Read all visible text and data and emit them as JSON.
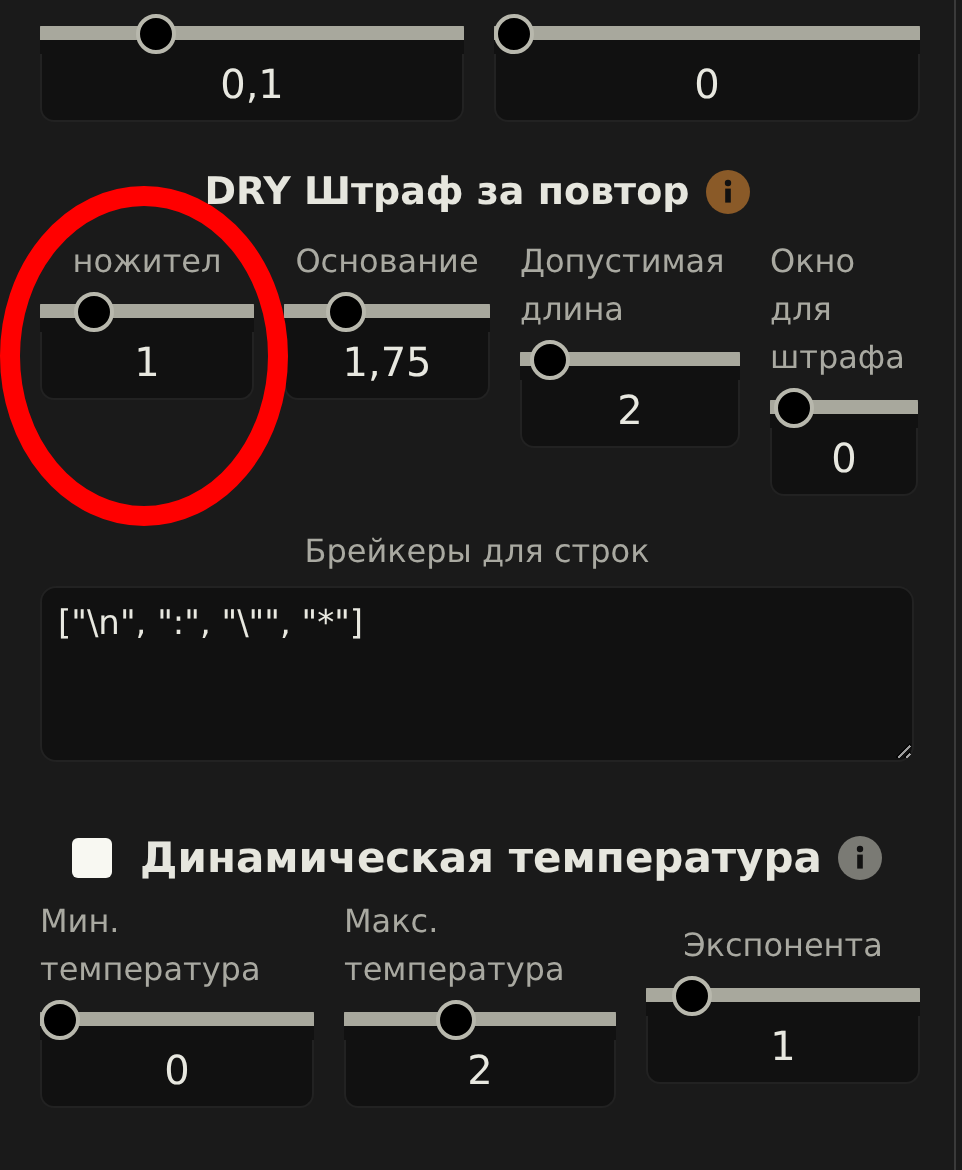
{
  "top_sliders": [
    {
      "value": "0,1",
      "level": 0.25
    },
    {
      "value": "0",
      "level": 0
    }
  ],
  "dry": {
    "title": "DRY Штраф за повтор",
    "sliders": [
      {
        "label": "ножител",
        "value": "1",
        "level": 0.2
      },
      {
        "label": "Основание",
        "value": "1,75",
        "level": 0.25
      },
      {
        "label": "Допустимая длина",
        "value": "2",
        "level": 0.06
      },
      {
        "label": "Окно для штрафа",
        "value": "0",
        "level": 0.04
      }
    ],
    "breakers": {
      "label": "Брейкеры для строк",
      "value": "[\"\\n\", \":\", \"\\\"\", \"*\"]"
    }
  },
  "dynamic_temperature": {
    "title": "Динамическая температура",
    "checked": false,
    "sliders": [
      {
        "label": "Мин. температура",
        "value": "0",
        "level": 0
      },
      {
        "label": "Макс. температура",
        "value": "2",
        "level": 0.4
      },
      {
        "label": "Экспонента",
        "value": "1",
        "level": 0.11
      }
    ]
  }
}
